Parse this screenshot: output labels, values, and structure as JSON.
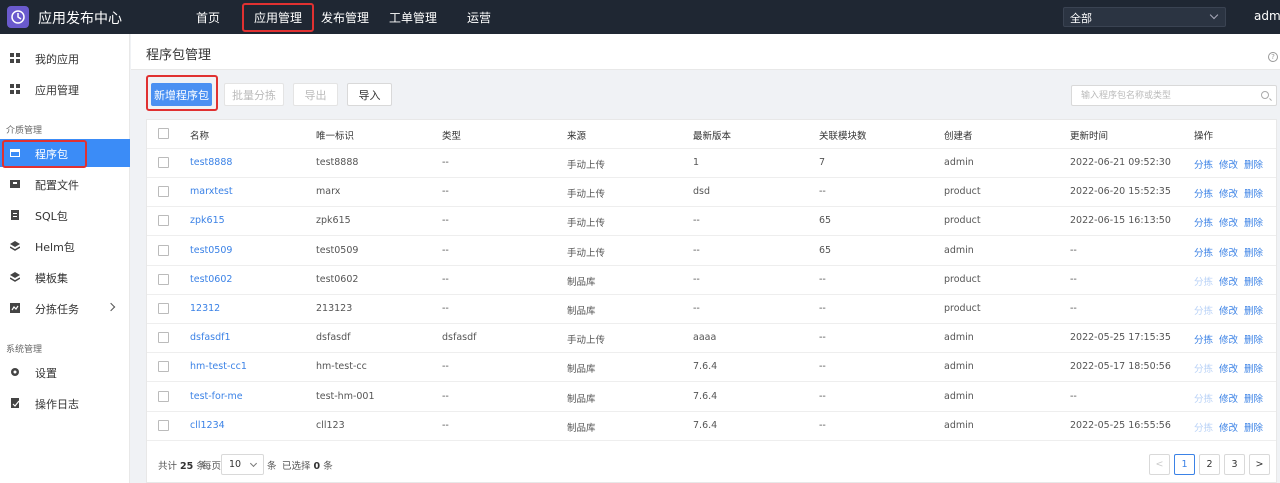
{
  "app": {
    "title": "应用发布中心"
  },
  "topnav": [
    {
      "label": "首页",
      "active": false
    },
    {
      "label": "应用管理",
      "active": true
    },
    {
      "label": "发布管理",
      "active": false
    },
    {
      "label": "工单管理",
      "active": false
    },
    {
      "label": "运营",
      "active": false
    }
  ],
  "topbar": {
    "selector_value": "全部",
    "user": "admin"
  },
  "sidebar": {
    "items_top": [
      {
        "label": "我的应用",
        "icon": "grid-icon"
      },
      {
        "label": "应用管理",
        "icon": "grid-icon"
      }
    ],
    "group1": "介质管理",
    "items_media": [
      {
        "label": "程序包",
        "icon": "package-icon",
        "active": true
      },
      {
        "label": "配置文件",
        "icon": "config-icon"
      },
      {
        "label": "SQL包",
        "icon": "sql-icon"
      },
      {
        "label": "Helm包",
        "icon": "layers-icon"
      },
      {
        "label": "模板集",
        "icon": "layers-icon"
      },
      {
        "label": "分拣任务",
        "icon": "task-icon",
        "has_children": true
      }
    ],
    "group2": "系统管理",
    "items_system": [
      {
        "label": "设置",
        "icon": "gear-icon"
      },
      {
        "label": "操作日志",
        "icon": "log-icon"
      }
    ]
  },
  "page": {
    "title": "程序包管理",
    "help": "?"
  },
  "toolbar": {
    "new": "新增程序包",
    "batch": "批量分拣",
    "export": "导出",
    "import": "导入",
    "search_placeholder": "输入程序包名称或类型"
  },
  "table": {
    "columns": [
      "名称",
      "唯一标识",
      "类型",
      "来源",
      "最新版本",
      "关联模块数",
      "创建者",
      "更新时间",
      "操作"
    ],
    "ops": {
      "sort": "分拣",
      "edit": "修改",
      "delete": "删除"
    },
    "rows": [
      {
        "name": "test8888",
        "id": "test8888",
        "type": "--",
        "source": "手动上传",
        "version": "1",
        "modules": "7",
        "creator": "admin",
        "updated": "2022-06-21 09:52:30",
        "sort_enabled": true
      },
      {
        "name": "marxtest",
        "id": "marx",
        "type": "--",
        "source": "手动上传",
        "version": "dsd",
        "modules": "--",
        "creator": "product",
        "updated": "2022-06-20 15:52:35",
        "sort_enabled": true
      },
      {
        "name": "zpk615",
        "id": "zpk615",
        "type": "--",
        "source": "手动上传",
        "version": "--",
        "modules": "65",
        "creator": "product",
        "updated": "2022-06-15 16:13:50",
        "sort_enabled": true
      },
      {
        "name": "test0509",
        "id": "test0509",
        "type": "--",
        "source": "手动上传",
        "version": "--",
        "modules": "65",
        "creator": "admin",
        "updated": "--",
        "sort_enabled": true
      },
      {
        "name": "test0602",
        "id": "test0602",
        "type": "--",
        "source": "制品库",
        "version": "--",
        "modules": "--",
        "creator": "product",
        "updated": "--",
        "sort_enabled": false
      },
      {
        "name": "12312",
        "id": "213123",
        "type": "--",
        "source": "制品库",
        "version": "--",
        "modules": "--",
        "creator": "product",
        "updated": "--",
        "sort_enabled": false
      },
      {
        "name": "dsfasdf1",
        "id": "dsfasdf",
        "type": "dsfasdf",
        "source": "手动上传",
        "version": "aaaa",
        "modules": "--",
        "creator": "admin",
        "updated": "2022-05-25 17:15:35",
        "sort_enabled": true
      },
      {
        "name": "hm-test-cc1",
        "id": "hm-test-cc",
        "type": "--",
        "source": "制品库",
        "version": "7.6.4",
        "modules": "--",
        "creator": "admin",
        "updated": "2022-05-17 18:50:56",
        "sort_enabled": false
      },
      {
        "name": "test-for-me",
        "id": "test-hm-001",
        "type": "--",
        "source": "制品库",
        "version": "7.6.4",
        "modules": "--",
        "creator": "admin",
        "updated": "--",
        "sort_enabled": false
      },
      {
        "name": "cll1234",
        "id": "cll123",
        "type": "--",
        "source": "制品库",
        "version": "7.6.4",
        "modules": "--",
        "creator": "admin",
        "updated": "2022-05-25 16:55:56",
        "sort_enabled": false
      }
    ]
  },
  "footer": {
    "total_prefix": "共计",
    "total": "25",
    "total_suffix": "条",
    "per_page_label": "每页",
    "per_page": "10",
    "per_page_suffix": "条",
    "selected_prefix": "已选择",
    "selected": "0",
    "selected_suffix": "条",
    "pages": [
      "1",
      "2",
      "3"
    ],
    "prev": "<",
    "next": ">"
  }
}
